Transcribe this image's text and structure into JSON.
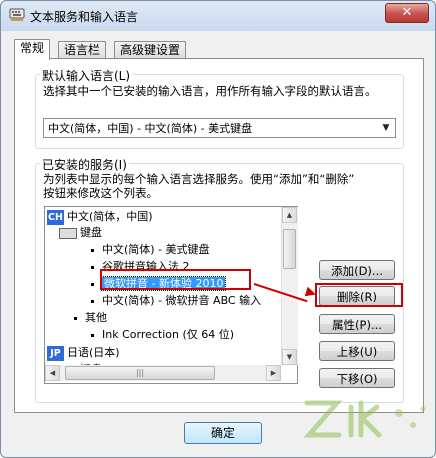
{
  "window": {
    "title": "文本服务和输入语言",
    "close_glyph": "✕"
  },
  "tabs": [
    {
      "label": "常规",
      "active": true
    },
    {
      "label": "语言栏",
      "active": false
    },
    {
      "label": "高级键设置",
      "active": false
    }
  ],
  "default_language": {
    "group_label": "默认输入语言(L)",
    "description": "选择其中一个已安装的输入语言，用作所有输入字段的默认语言。",
    "selected_value": "中文(简体，中国) - 中文(简体) - 美式键盘"
  },
  "installed_services": {
    "group_label": "已安装的服务(I)",
    "description_line1": "为列表中显示的每个输入语言选择服务。使用“添加”和“删除”",
    "description_line2": "按钮来修改这个列表。",
    "tree": {
      "lang_cn_badge": "CH",
      "lang_cn": "中文(简体，中国)",
      "keyboard_cn": "键盘",
      "item_us_keyboard": "中文(简体) - 美式键盘",
      "item_google_pinyin": "谷歌拼音输入法 2",
      "item_ms_pinyin_new": "微软拼音 - 新体验 2010",
      "item_ms_pinyin_abc": "中文(简体) - 微软拼音 ABC 输入",
      "other_cn": "其他",
      "item_ink_correction": "Ink Correction (仅 64 位)",
      "lang_jp_badge": "JP",
      "lang_jp": "日语(日本)",
      "keyboard_jp": "键盘"
    }
  },
  "buttons": {
    "add": "添加(D)...",
    "remove": "删除(R)",
    "properties": "属性(P)...",
    "move_up": "上移(U)",
    "move_down": "下移(O)",
    "ok": "确定"
  },
  "colors": {
    "annotation_red": "#cc0000",
    "selection_blue": "#3399ff",
    "badge_blue": "#2e6bd6"
  }
}
